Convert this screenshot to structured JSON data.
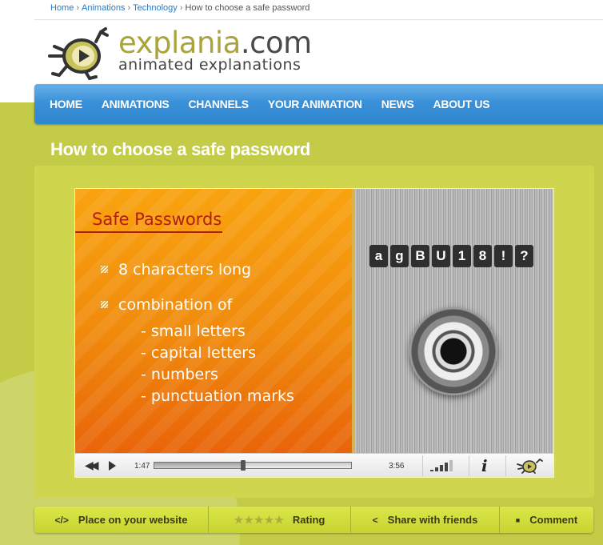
{
  "breadcrumb": {
    "items": [
      "Home",
      "Animations",
      "Technology"
    ],
    "current": "How to choose a safe password",
    "separator": "›"
  },
  "logo": {
    "name": "explania",
    "tld": ".com",
    "tagline": "animated explanations"
  },
  "nav": {
    "items": [
      "HOME",
      "ANIMATIONS",
      "CHANNELS",
      "YOUR ANIMATION",
      "NEWS",
      "ABOUT US"
    ]
  },
  "page": {
    "title": "How to choose a safe password"
  },
  "slide": {
    "title": "Safe Passwords",
    "bullets": [
      "8 characters long",
      "combination of"
    ],
    "sub_items": [
      "- small letters",
      "- capital letters",
      "- numbers",
      "- punctuation marks"
    ],
    "password_chars": [
      "a",
      "g",
      "B",
      "U",
      "1",
      "8",
      "!",
      "?"
    ]
  },
  "player": {
    "current_time": "1:47",
    "total_time": "3:56",
    "progress_fraction": 0.453,
    "volume_level": 4,
    "volume_max": 5,
    "info_label": "i"
  },
  "actions": {
    "embed": {
      "icon": "</>",
      "label": "Place on your website"
    },
    "rating": {
      "stars": "★★★★★",
      "label": "Rating",
      "value": 0
    },
    "share": {
      "icon": "<",
      "label": "Share with friends"
    },
    "comment": {
      "icon": "■",
      "label": "Comment"
    }
  },
  "colors": {
    "nav_blue": "#3a91d8",
    "page_green": "#c3cb47",
    "slide_orange": "#f08a0c",
    "slide_title_red": "#b3200a",
    "link_blue": "#2a7ac0"
  }
}
